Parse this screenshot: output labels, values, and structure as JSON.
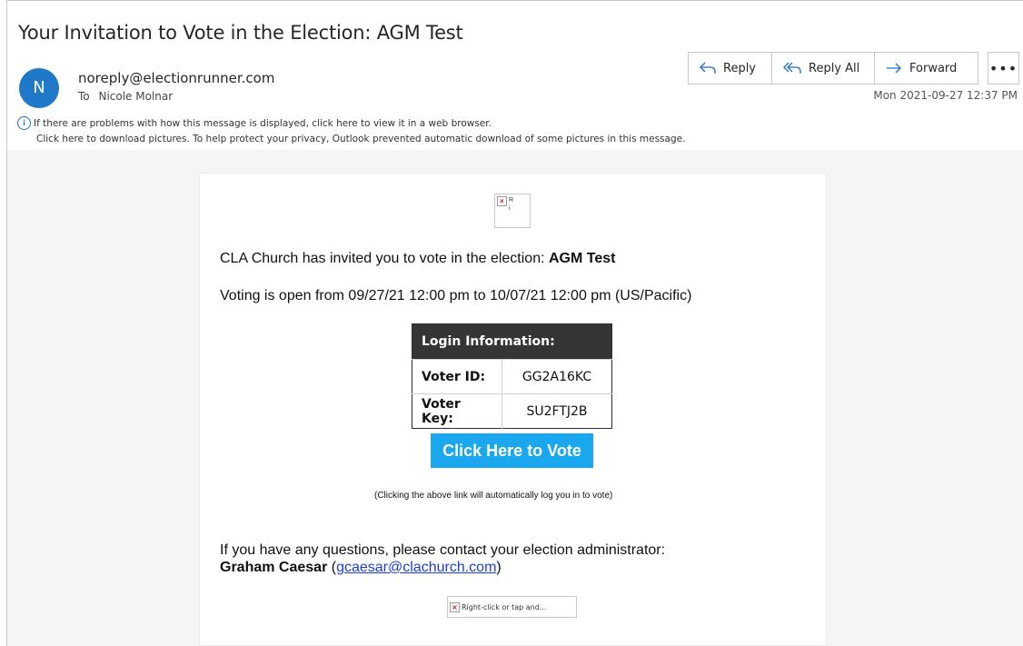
{
  "email": {
    "subject": "Your Invitation to Vote in the Election: AGM Test",
    "avatar_initial": "N",
    "sender": "noreply@electionrunner.com",
    "to_label": "To",
    "recipient": "Nicole Molnar",
    "datetime": "Mon 2021-09-27 12:37 PM"
  },
  "actions": {
    "reply": "Reply",
    "reply_all": "Reply All",
    "forward": "Forward",
    "more": "•••"
  },
  "info_bar": {
    "line1": "If there are problems with how this message is displayed, click here to view it in a web browser.",
    "line2": "Click here to download pictures. To help protect your privacy, Outlook prevented automatic download of some pictures in this message."
  },
  "body": {
    "logo_alt": "R\ni",
    "invite_prefix": "CLA Church has invited you to vote in the election: ",
    "election_name": "AGM Test",
    "voting_open": "Voting is open from 09/27/21 12:00 pm to 10/07/21 12:00 pm (US/Pacific)",
    "login_header": "Login Information:",
    "voter_id_label": "Voter ID:",
    "voter_id": "GG2A16KC",
    "voter_key_label": "Voter Key:",
    "voter_key": "SU2FTJ2B",
    "vote_button": "Click Here to Vote",
    "vote_note": "(Clicking the above link will automatically log you in to vote)",
    "questions": "If you have any questions, please contact your election administrator:",
    "admin_name": "Graham Caesar",
    "admin_email": "gcaesar@clachurch.com",
    "footer_img_alt": "Right-click or tap and..."
  },
  "colors": {
    "avatar": "#1f78c8",
    "vote_button": "#1aa7ee",
    "login_header": "#353535",
    "link": "#1a3fd0",
    "icon_blue": "#1f6fc5"
  }
}
